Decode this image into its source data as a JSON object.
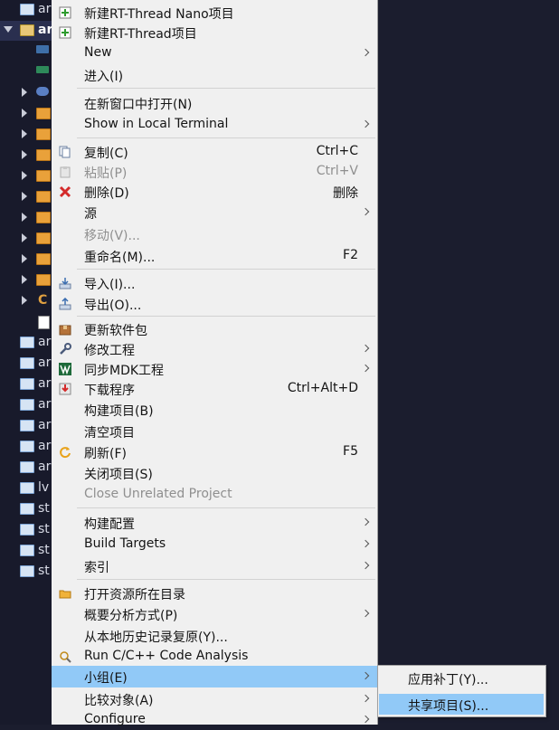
{
  "tree": {
    "rows": [
      {
        "label": "ar",
        "icon": "folder-blue"
      },
      {
        "label": "ar",
        "icon": "project-open"
      },
      {
        "label": "",
        "icon": "rt-icon"
      },
      {
        "label": "",
        "icon": "chip-icon"
      },
      {
        "label": "",
        "icon": "binary-icon"
      },
      {
        "label": "",
        "icon": "folder-orange"
      },
      {
        "label": "",
        "icon": "folder-orange"
      },
      {
        "label": "",
        "icon": "folder-orange"
      },
      {
        "label": "",
        "icon": "folder-orange"
      },
      {
        "label": "",
        "icon": "folder-orange"
      },
      {
        "label": "",
        "icon": "folder-orange"
      },
      {
        "label": "",
        "icon": "folder-orange"
      },
      {
        "label": "",
        "icon": "folder-orange"
      },
      {
        "label": "",
        "icon": "folder-orange"
      },
      {
        "label": "C",
        "icon": "c-source"
      },
      {
        "label": "",
        "icon": "word-doc"
      },
      {
        "label": "ar",
        "icon": "folder-blue"
      },
      {
        "label": "ar",
        "icon": "folder-blue"
      },
      {
        "label": "ar",
        "icon": "folder-blue"
      },
      {
        "label": "ar",
        "icon": "folder-blue"
      },
      {
        "label": "ar",
        "icon": "folder-blue"
      },
      {
        "label": "ar",
        "icon": "folder-blue"
      },
      {
        "label": "ar",
        "icon": "folder-blue"
      },
      {
        "label": "lv",
        "icon": "folder-blue"
      },
      {
        "label": "st",
        "icon": "folder-blue"
      },
      {
        "label": "st",
        "icon": "folder-blue"
      },
      {
        "label": "st",
        "icon": "folder-blue"
      },
      {
        "label": "st",
        "icon": "folder-blue"
      }
    ]
  },
  "menu": {
    "items": [
      {
        "label": "新建RT-Thread Nano项目",
        "accel": "",
        "icon": "new-project-icon"
      },
      {
        "label": "新建RT-Thread项目",
        "accel": "",
        "icon": "new-project-icon"
      },
      {
        "label": "New",
        "accel": "",
        "icon": ""
      },
      {
        "label": "进入(I)",
        "accel": "",
        "icon": ""
      },
      {
        "label": "在新窗口中打开(N)",
        "accel": "",
        "icon": ""
      },
      {
        "label": "Show in Local Terminal",
        "accel": "",
        "icon": ""
      },
      {
        "label": "复制(C)",
        "accel": "Ctrl+C",
        "icon": "copy-icon"
      },
      {
        "label": "粘贴(P)",
        "accel": "Ctrl+V",
        "icon": "paste-icon"
      },
      {
        "label": "删除(D)",
        "accel": "删除",
        "icon": "delete-icon"
      },
      {
        "label": "源",
        "accel": "",
        "icon": ""
      },
      {
        "label": "移动(V)...",
        "accel": "",
        "icon": ""
      },
      {
        "label": "重命名(M)...",
        "accel": "F2",
        "icon": ""
      },
      {
        "label": "导入(I)...",
        "accel": "",
        "icon": "import-icon"
      },
      {
        "label": "导出(O)...",
        "accel": "",
        "icon": "export-icon"
      },
      {
        "label": "更新软件包",
        "accel": "",
        "icon": "package-icon"
      },
      {
        "label": "修改工程",
        "accel": "",
        "icon": "wrench-icon"
      },
      {
        "label": "同步MDK工程",
        "accel": "",
        "icon": "mdk-icon"
      },
      {
        "label": "下载程序",
        "accel": "Ctrl+Alt+D",
        "icon": "download-icon"
      },
      {
        "label": "构建项目(B)",
        "accel": "",
        "icon": ""
      },
      {
        "label": "清空项目",
        "accel": "",
        "icon": ""
      },
      {
        "label": "刷新(F)",
        "accel": "F5",
        "icon": "refresh-icon"
      },
      {
        "label": "关闭项目(S)",
        "accel": "",
        "icon": ""
      },
      {
        "label": "Close Unrelated Project",
        "accel": "",
        "icon": ""
      },
      {
        "label": "构建配置",
        "accel": "",
        "icon": ""
      },
      {
        "label": "Build Targets",
        "accel": "",
        "icon": ""
      },
      {
        "label": "索引",
        "accel": "",
        "icon": ""
      },
      {
        "label": "打开资源所在目录",
        "accel": "",
        "icon": "folder-open-icon"
      },
      {
        "label": "概要分析方式(P)",
        "accel": "",
        "icon": ""
      },
      {
        "label": "从本地历史记录复原(Y)...",
        "accel": "",
        "icon": ""
      },
      {
        "label": "Run C/C++ Code Analysis",
        "accel": "",
        "icon": "code-analysis-icon"
      },
      {
        "label": "小组(E)",
        "accel": "",
        "icon": ""
      },
      {
        "label": "比较对象(A)",
        "accel": "",
        "icon": ""
      },
      {
        "label": "Configure",
        "accel": "",
        "icon": ""
      }
    ]
  },
  "submenu": {
    "items": [
      {
        "label": "应用补丁(Y)..."
      },
      {
        "label": "共享项目(S)..."
      }
    ]
  },
  "colors": {
    "selection": "#91c9f7",
    "menu_bg": "#f0f0f0",
    "explorer_bg": "#181a2b"
  }
}
